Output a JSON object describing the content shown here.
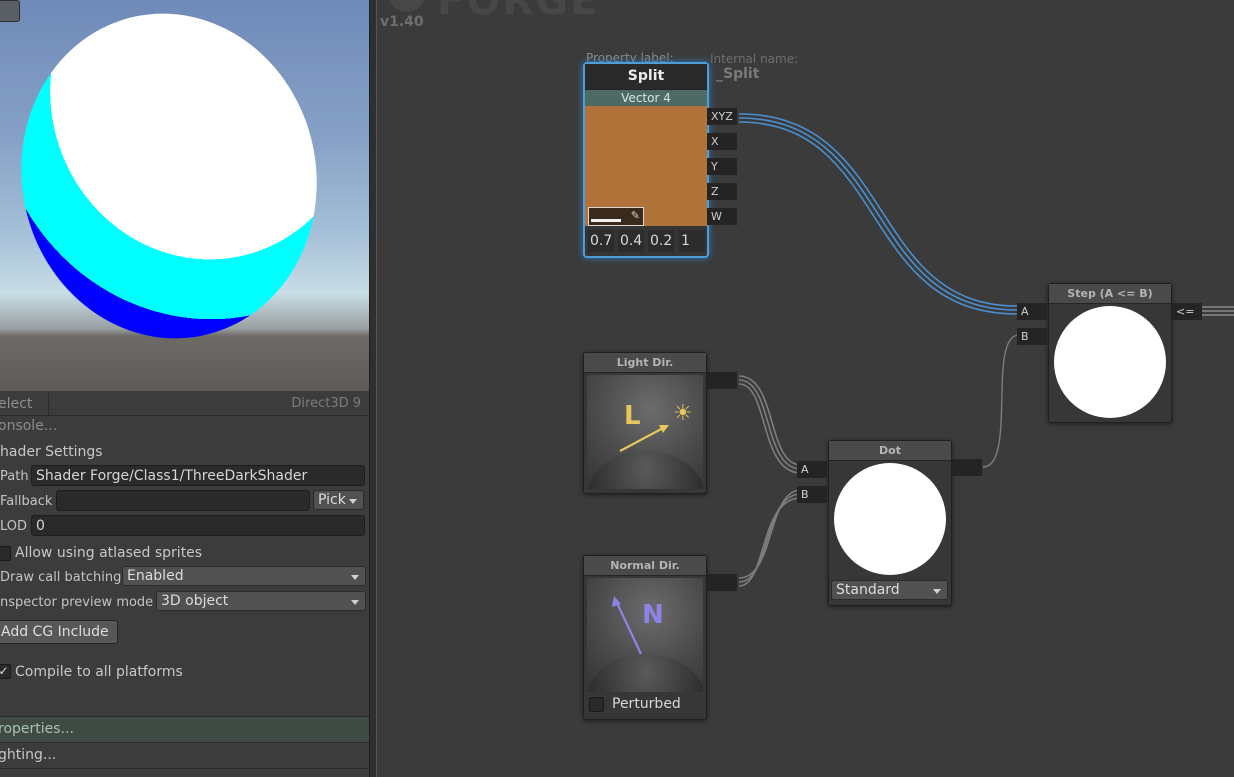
{
  "app": {
    "version": "v1.40",
    "logo_text": "FORGE"
  },
  "left_panel": {
    "preview_renderer": "Direct3D 9",
    "tabs": {
      "select": "elect",
      "console": "onsole..."
    },
    "shader_settings": {
      "heading": "hader Settings",
      "path_label": "Path",
      "path_value": "Shader Forge/Class1/ThreeDarkShader",
      "fallback_label": "Fallback",
      "fallback_value": "",
      "pick_button": "Pick",
      "lod_label": "LOD",
      "lod_value": "0",
      "allow_atlased_label": "Allow using atlased sprites",
      "draw_call_label": "Draw call batching",
      "draw_call_value": "Enabled",
      "preview_mode_label": "nspector preview mode",
      "preview_mode_value": "3D object",
      "add_cg_include": "Add CG Include",
      "compile_all_label": "Compile to all platforms",
      "compile_all_checked": true,
      "allow_atlased_checked": false
    },
    "sections": {
      "properties": "roperties...",
      "lighting": "ghting..."
    }
  },
  "canvas": {
    "split_node": {
      "property_label_caption": "Property label:",
      "internal_name_caption": "Internal name:",
      "internal_name_value": "_Split",
      "title": "Split",
      "type_label": "Vector 4",
      "swatch_color": "#b2733a",
      "values": [
        "0.7",
        "0.4",
        "0.2",
        "1"
      ],
      "outputs": [
        "XYZ",
        "X",
        "Y",
        "Z",
        "W"
      ]
    },
    "step_node": {
      "title": "Step (A <= B)",
      "inputs": [
        "A",
        "B"
      ],
      "output": "<="
    },
    "light_dir_node": {
      "title": "Light Dir.",
      "glyph": "L"
    },
    "normal_dir_node": {
      "title": "Normal Dir.",
      "glyph": "N",
      "perturbed_label": "Perturbed",
      "perturbed_checked": false
    },
    "dot_node": {
      "title": "Dot",
      "inputs": [
        "A",
        "B"
      ],
      "mode_value": "Standard"
    }
  },
  "colors": {
    "selection_glow": "#4e9cd8",
    "wire_selected": "#4a90d0",
    "wire_default": "#7d7d7d"
  }
}
